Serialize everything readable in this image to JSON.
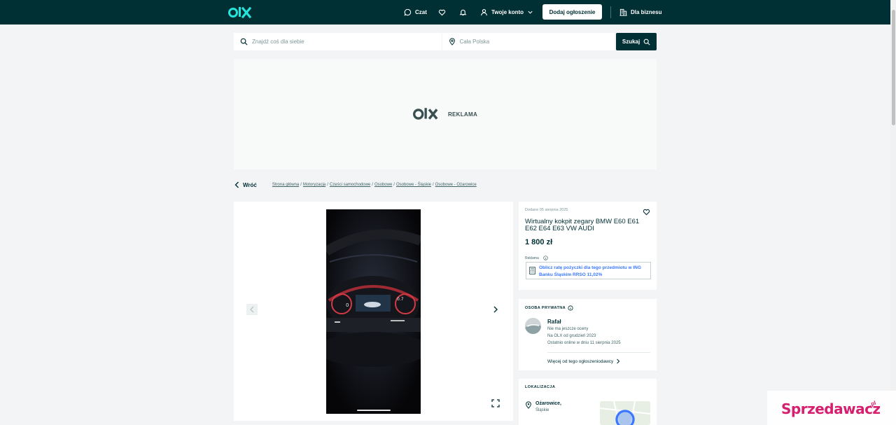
{
  "header": {
    "chat_label": "Czat",
    "account_label": "Twoje konto",
    "add_label": "Dodaj ogłoszenie",
    "business_label": "Dla biznesu"
  },
  "search": {
    "placeholder": "Znajdź coś dla siebie",
    "location": "Cała Polska",
    "button_label": "Szukaj"
  },
  "ad": {
    "label": "REKLAMA"
  },
  "breadcrumb": {
    "back_label": "Wróć",
    "items": [
      "Strona główna",
      "Motoryzacja",
      "Części samochodowe",
      "Osobowe",
      "Osobowe - Śląskie",
      "Osobowe - Ożarowice"
    ]
  },
  "listing": {
    "posted": "Dodane 05 sierpnia 2025",
    "title": "Wirtualny kokpit zegary BMW E60 E61 E62 E64 E63 VW AUDI",
    "price": "1 800 zł",
    "ad_label": "Reklama",
    "loan_text": "Oblicz ratę pożyczki dla tego przedmiotu w ING Banku Śląskim RRSO 11,02%"
  },
  "seller": {
    "section_title": "OSOBA PRYWATNA",
    "name": "Rafał",
    "rating": "Nie ma jeszcze oceny",
    "since": "Na OLX od grudzień 2023",
    "online": "Ostatnio online w dniu 11 sierpnia 2025",
    "more_label": "Więcej od tego ogłoszeniodawcy"
  },
  "location": {
    "section_title": "LOKALIZACJA",
    "city": "Ożarowice,",
    "region": "Śląskie"
  },
  "watermark": {
    "text": "Sprzedawacz",
    "suffix": ".pl"
  },
  "colors": {
    "brand_dark": "#002f34",
    "logo_teal": "#23e5db",
    "link_blue": "#3a77ff",
    "watermark_pink": "#d6206f"
  }
}
